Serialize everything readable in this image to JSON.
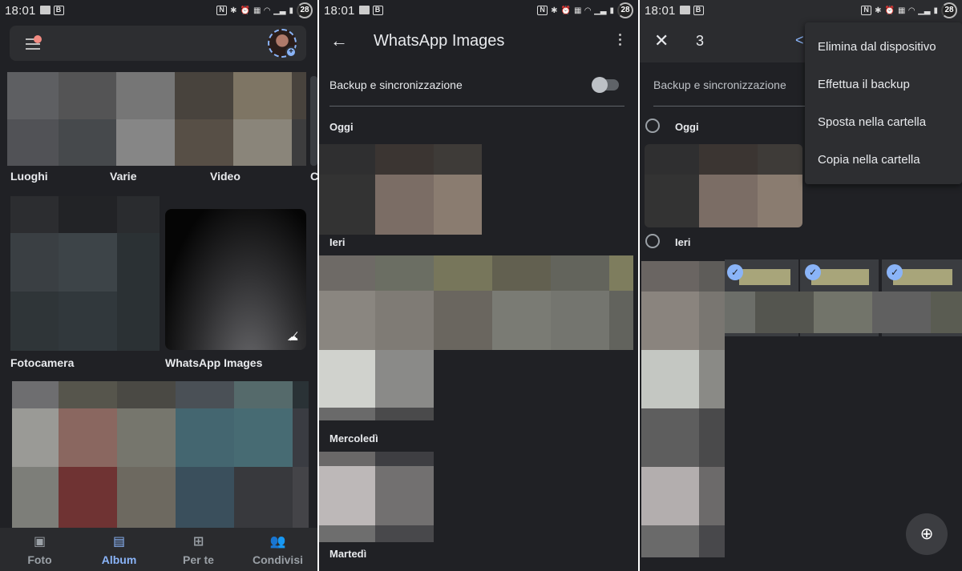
{
  "status_bar": {
    "time": "18:01",
    "left_icons": [
      "gallery-icon",
      "b-badge-icon"
    ],
    "right_icons": [
      "nfc-icon",
      "bluetooth-icon",
      "alarm-icon",
      "volte-icon",
      "wifi-icon",
      "signal-icon",
      "battery-icon"
    ],
    "b_label": "B",
    "n_label": "N",
    "battery_level": "28"
  },
  "screen1": {
    "albums_row1": [
      {
        "label": "Luoghi"
      },
      {
        "label": "Varie"
      },
      {
        "label": "Video"
      },
      {
        "label": "C"
      }
    ],
    "albums_row2": [
      {
        "label": "Fotocamera"
      },
      {
        "label": "WhatsApp Images",
        "icon": "cloud-off-icon"
      }
    ],
    "bottom_nav": [
      {
        "label": "Foto",
        "icon": "photo-icon",
        "active": false
      },
      {
        "label": "Album",
        "icon": "album-icon",
        "active": true
      },
      {
        "label": "Per te",
        "icon": "for-you-icon",
        "active": false
      },
      {
        "label": "Condivisi",
        "icon": "shared-icon",
        "active": false
      }
    ]
  },
  "screen2": {
    "title": "WhatsApp Images",
    "backup_label": "Backup e sincronizzazione",
    "backup_enabled": false,
    "sections": [
      "Oggi",
      "Ieri",
      "Mercoledì",
      "Martedì"
    ]
  },
  "screen3": {
    "selected_count": "3",
    "backup_label": "Backup e sincronizzazione",
    "sections": [
      "Oggi",
      "Ieri"
    ],
    "menu_items": [
      "Elimina dal dispositivo",
      "Effettua il backup",
      "Sposta nella cartella",
      "Copia nella cartella"
    ],
    "check_glyph": "✓"
  },
  "colors": {
    "background": "#202125",
    "accent": "#8ab4f8",
    "surface": "#2d2e31"
  }
}
